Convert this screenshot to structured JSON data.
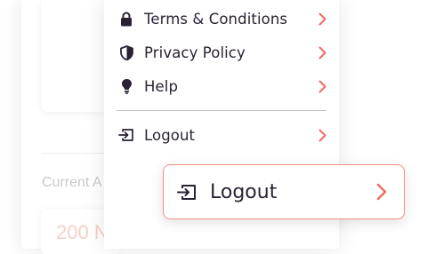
{
  "background": {
    "current_label": "Current A",
    "amount_text": "200 N"
  },
  "menu": {
    "items": [
      {
        "label": "Terms & Conditions",
        "icon": "lock-icon"
      },
      {
        "label": "Privacy Policy",
        "icon": "shield-icon"
      },
      {
        "label": "Help",
        "icon": "lightbulb-icon"
      },
      {
        "label": "Logout",
        "icon": "logout-icon"
      }
    ]
  },
  "highlight": {
    "label": "Logout",
    "icon": "logout-icon"
  },
  "colors": {
    "accent": "#ef6b64",
    "text": "#2a2233",
    "highlight_border": "#ef8e88"
  }
}
